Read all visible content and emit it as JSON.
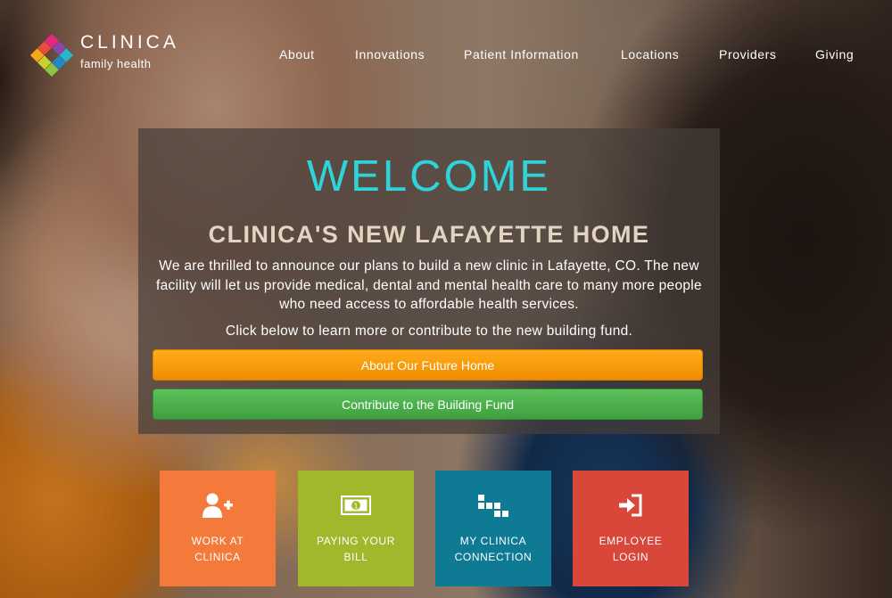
{
  "brand": {
    "name": "CLINICA",
    "tagline": "family health",
    "logo_colors": [
      "#e94b3c",
      "#f7a81b",
      "#8cc63f",
      "#27b5c9",
      "#8e44ad",
      "#e5287b"
    ]
  },
  "nav": {
    "items": [
      {
        "label": "About"
      },
      {
        "label": "Innovations"
      },
      {
        "label": "Patient Information"
      },
      {
        "label": "Locations"
      },
      {
        "label": "Providers"
      },
      {
        "label": "Giving"
      }
    ]
  },
  "welcome": {
    "title": "WELCOME",
    "subtitle": "CLINICA'S NEW LAFAYETTE HOME",
    "body": "We are thrilled to announce our plans to build a new clinic in Lafayette, CO. The new facility will let us provide medical, dental and mental health care to many more people who need access to affordable health services.",
    "cta_text": "Click below to learn more or contribute to the new building fund.",
    "title_color": "#2fd3d9",
    "buttons": [
      {
        "label": "About Our Future Home",
        "color": "#f7970e"
      },
      {
        "label": "Contribute to the Building Fund",
        "color": "#4cb04c"
      }
    ]
  },
  "tiles": [
    {
      "line1": "WORK AT",
      "line2": "CLINICA",
      "icon": "add-user-icon",
      "color": "#f47a3b"
    },
    {
      "line1": "PAYING YOUR",
      "line2": "BILL",
      "icon": "dollar-bill-icon",
      "color": "#a2b82c"
    },
    {
      "line1": "MY CLINICA",
      "line2": "CONNECTION",
      "icon": "grid-blocks-icon",
      "color": "#0f7a94"
    },
    {
      "line1": "EMPLOYEE",
      "line2": "LOGIN",
      "icon": "sign-in-icon",
      "color": "#d9473a"
    }
  ]
}
